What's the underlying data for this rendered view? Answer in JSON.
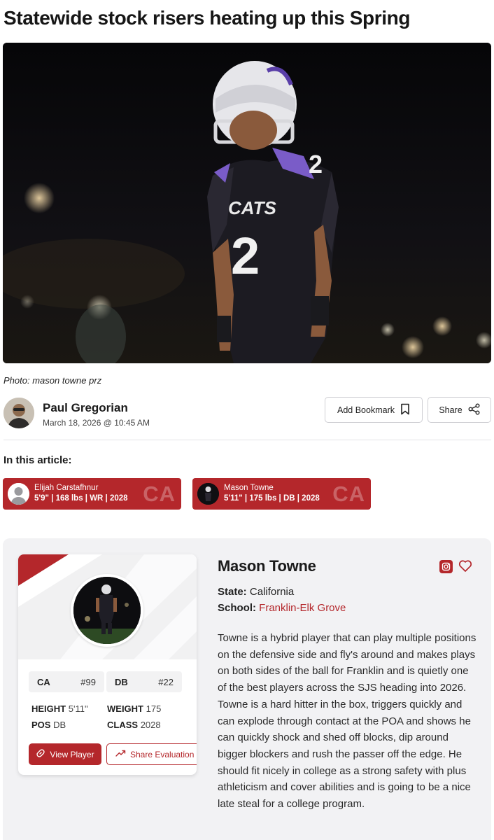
{
  "article": {
    "headline": "Statewide stock risers heating up this Spring",
    "photo_caption": "Photo: mason towne prz",
    "author": "Paul Gregorian",
    "date": "March 18, 2026 @ 10:45 AM",
    "bookmark_label": "Add Bookmark",
    "share_label": "Share",
    "in_article_label": "In this article:"
  },
  "hero_photo": {
    "jersey_text": "CATS",
    "jersey_number": "2"
  },
  "players": [
    {
      "name": "Elijah Carstafhnur",
      "meta": "5'9\" | 168 lbs | WR | 2028",
      "state": "CA"
    },
    {
      "name": "Mason Towne",
      "meta": "5'11\" | 175 lbs | DB | 2028",
      "state": "CA"
    }
  ],
  "profile": {
    "name": "Mason Towne",
    "state_label": "State:",
    "state_value": "California",
    "school_label": "School:",
    "school_value": "Franklin-Elk Grove",
    "bio": "Towne is a hybrid player that can play multiple positions on the defensive side and fly's around and makes plays on both sides of the ball for Franklin and is quietly one of the best players across the SJS heading into 2026. Towne is a hard hitter in the box, triggers quickly and can explode through contact at the POA and shows he can quickly shock and shed off blocks, dip around bigger blockers and rush the passer off the edge. He should fit nicely in college as a strong safety with plus athleticism and cover abilities and is going to be a nice late steal for a college program.",
    "ranks": [
      {
        "label": "CA",
        "value": "#99"
      },
      {
        "label": "DB",
        "value": "#22"
      }
    ],
    "stats": {
      "height_label": "HEIGHT",
      "height": "5'11\"",
      "weight_label": "WEIGHT",
      "weight": "175",
      "pos_label": "POS",
      "pos": "DB",
      "class_label": "CLASS",
      "class": "2028"
    },
    "view_label": "View Player",
    "eval_label": "Share Evaluation"
  },
  "icons": {
    "bookmark": "bookmark-icon",
    "share": "share-icon",
    "instagram": "instagram-icon",
    "heart": "heart-icon",
    "link": "link-icon",
    "trend": "trend-icon"
  },
  "colors": {
    "brand_red": "#b4272b",
    "panel_bg": "#f2f2f4",
    "jersey_purple": "#7a5cc8"
  }
}
